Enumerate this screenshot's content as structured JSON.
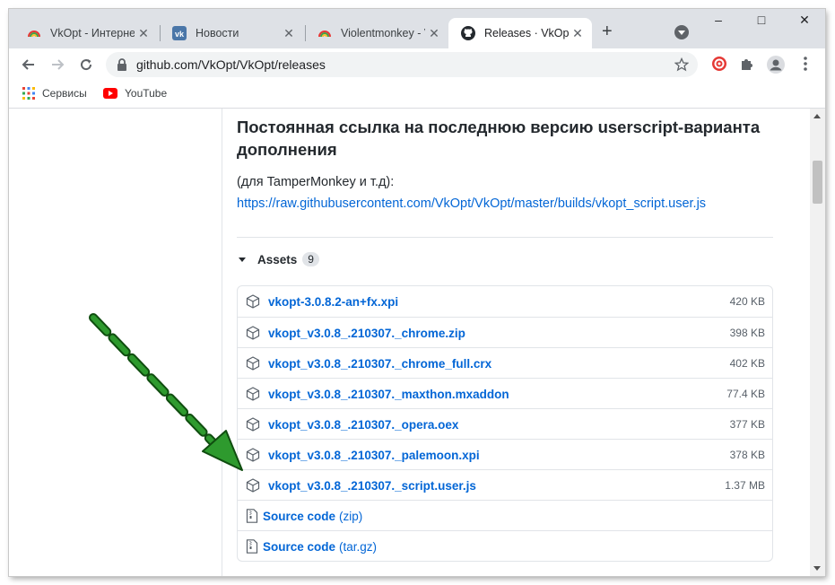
{
  "tabs": [
    {
      "title": "VkOpt - Интернет",
      "icon": "rainbow-icon"
    },
    {
      "title": "Новости",
      "icon": "vk-icon"
    },
    {
      "title": "Violentmonkey - V",
      "icon": "rainbow-icon"
    },
    {
      "title": "Releases · VkOpt/V",
      "icon": "github-icon",
      "active": true
    }
  ],
  "toolbar": {
    "url": "github.com/VkOpt/VkOpt/releases"
  },
  "bookmarks": [
    {
      "label": "Сервисы",
      "icon": "apps-grid-icon"
    },
    {
      "label": "YouTube",
      "icon": "youtube-icon"
    }
  ],
  "release": {
    "heading": "Постоянная ссылка на последнюю версию userscript-варианта дополнения",
    "note": "(для TamperMonkey и т.д):",
    "link": "https://raw.githubusercontent.com/VkOpt/VkOpt/master/builds/vkopt_script.user.js",
    "assets_label": "Assets",
    "assets_count": "9"
  },
  "assets": [
    {
      "name": "vkopt-3.0.8.2-an+fx.xpi",
      "size": "420 KB"
    },
    {
      "name": "vkopt_v3.0.8_.210307._chrome.zip",
      "size": "398 KB"
    },
    {
      "name": "vkopt_v3.0.8_.210307._chrome_full.crx",
      "size": "402 KB"
    },
    {
      "name": "vkopt_v3.0.8_.210307._maxthon.mxaddon",
      "size": "77.4 KB"
    },
    {
      "name": "vkopt_v3.0.8_.210307._opera.oex",
      "size": "377 KB"
    },
    {
      "name": "vkopt_v3.0.8_.210307._palemoon.xpi",
      "size": "378 KB"
    },
    {
      "name": "vkopt_v3.0.8_.210307._script.user.js",
      "size": "1.37 MB"
    }
  ],
  "sources": [
    {
      "label": "Source code",
      "format": "(zip)"
    },
    {
      "label": "Source code",
      "format": "(tar.gz)"
    }
  ],
  "colors": {
    "link": "#0366d6",
    "annotation_arrow": "#1e8a1e"
  }
}
